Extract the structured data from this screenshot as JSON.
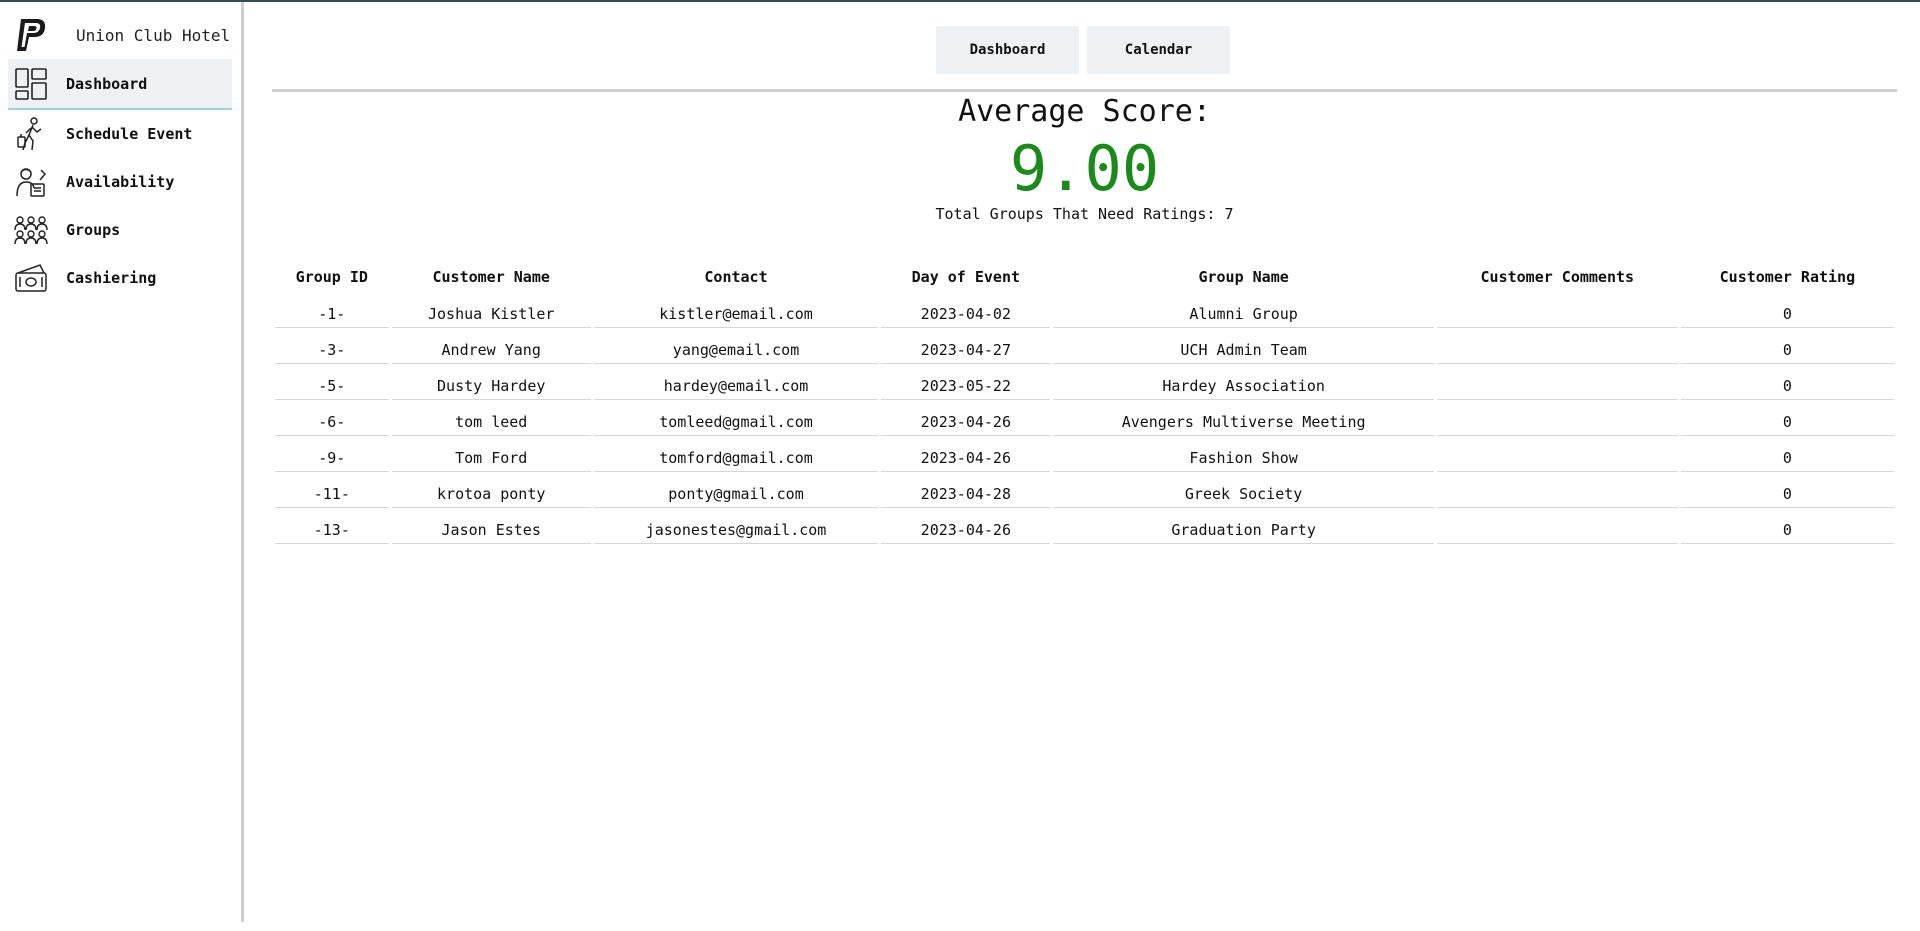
{
  "brand": {
    "name": "Union Club Hotel",
    "logo_icon": "p-logo-icon"
  },
  "sidebar": {
    "items": [
      {
        "label": "Dashboard",
        "icon": "dashboard-icon",
        "active": true
      },
      {
        "label": "Schedule Event",
        "icon": "traveler-icon",
        "active": false
      },
      {
        "label": "Availability",
        "icon": "receptionist-icon",
        "active": false
      },
      {
        "label": "Groups",
        "icon": "group-icon",
        "active": false
      },
      {
        "label": "Cashiering",
        "icon": "cash-icon",
        "active": false
      }
    ]
  },
  "tabs": {
    "dashboard_label": "Dashboard",
    "calendar_label": "Calendar"
  },
  "score": {
    "title": "Average Score:",
    "value": "9.00",
    "subtitle": "Total Groups That Need Ratings: 7",
    "value_color": "#1a8a1a"
  },
  "table": {
    "headers": [
      "Group ID",
      "Customer Name",
      "Contact",
      "Day of Event",
      "Group Name",
      "Customer Comments",
      "Customer Rating"
    ],
    "rows": [
      [
        "-1-",
        "Joshua Kistler",
        "kistler@email.com",
        "2023-04-02",
        "Alumni Group",
        "",
        "0"
      ],
      [
        "-3-",
        "Andrew Yang",
        "yang@email.com",
        "2023-04-27",
        "UCH Admin Team",
        "",
        "0"
      ],
      [
        "-5-",
        "Dusty Hardey",
        "hardey@email.com",
        "2023-05-22",
        "Hardey Association",
        "",
        "0"
      ],
      [
        "-6-",
        "tom leed",
        "tomleed@gmail.com",
        "2023-04-26",
        "Avengers Multiverse Meeting",
        "",
        "0"
      ],
      [
        "-9-",
        "Tom Ford",
        "tomford@gmail.com",
        "2023-04-26",
        "Fashion Show",
        "",
        "0"
      ],
      [
        "-11-",
        "krotoa ponty",
        "ponty@gmail.com",
        "2023-04-28",
        "Greek Society",
        "",
        "0"
      ],
      [
        "-13-",
        "Jason Estes",
        "jasonestes@gmail.com",
        "2023-04-26",
        "Graduation Party",
        "",
        "0"
      ]
    ]
  }
}
